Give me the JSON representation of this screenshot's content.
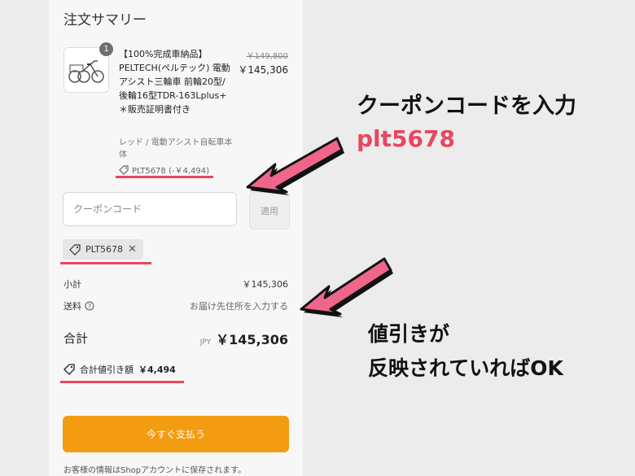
{
  "summary": {
    "title": "注文サマリー"
  },
  "product": {
    "quantity": "1",
    "name": "【100%完成車納品】PELTECH(ペルテック) 電動アシスト三輪車 前輪20型/後輪16型TDR-163Lplus+ ＊販売証明書付き",
    "variant": "レッド / 電動アシスト自転車本体",
    "original_price": "￥149,800",
    "price": "￥145,306",
    "discount_tag": "PLT5678 (-￥4,494)",
    "image_icon": "tricycle-icon"
  },
  "coupon": {
    "placeholder": "クーポンコード",
    "apply_label": "適用",
    "applied_code": "PLT5678",
    "remove_icon": "close-icon"
  },
  "rows": {
    "subtotal_label": "小計",
    "subtotal_value": "￥145,306",
    "shipping_label": "送料",
    "shipping_value": "お届け先住所を入力する"
  },
  "total": {
    "label": "合計",
    "currency": "JPY",
    "value": "￥145,306",
    "discount_label": "合計値引き額",
    "discount_value": "￥4,494"
  },
  "pay_button": "今すぐ支払う",
  "footer_note": "お客様の情報はShopアカウントに保存されます。",
  "annotations": {
    "enter_coupon": "クーポンコードを入力",
    "coupon_code": "plt5678",
    "line1": "値引きが",
    "line2": "反映されていればOK"
  },
  "colors": {
    "accent_red": "#e8475f",
    "pay_orange": "#f39c12",
    "arrow_pink": "#f0668a"
  }
}
